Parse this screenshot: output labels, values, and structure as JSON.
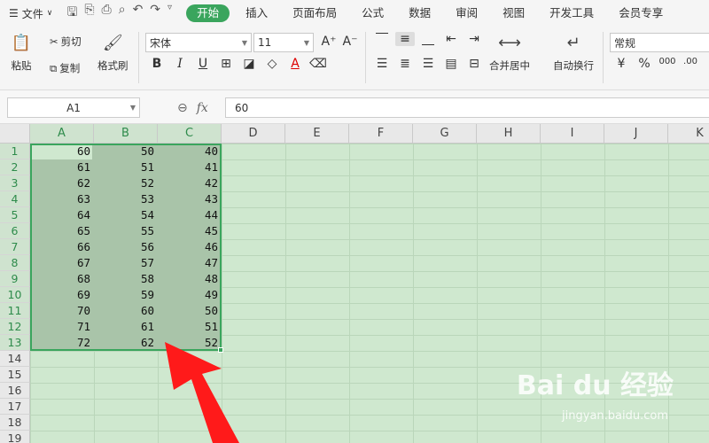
{
  "menu": {
    "file": "文件"
  },
  "tabs": [
    "开始",
    "插入",
    "页面布局",
    "公式",
    "数据",
    "审阅",
    "视图",
    "开发工具",
    "会员专享"
  ],
  "ribbon": {
    "paste": "粘贴",
    "cut": "剪切",
    "copy": "复制",
    "format_painter": "格式刷",
    "font_name": "宋体",
    "font_size": "11",
    "merge_center": "合并居中",
    "wrap_text": "自动换行",
    "number_format": "常规"
  },
  "formula_bar": {
    "name_box": "A1",
    "fx": "fx",
    "value": "60"
  },
  "columns": [
    "A",
    "B",
    "C",
    "D",
    "E",
    "F",
    "G",
    "H",
    "I",
    "J",
    "K"
  ],
  "rows": [
    "1",
    "2",
    "3",
    "4",
    "5",
    "6",
    "7",
    "8",
    "9",
    "10",
    "11",
    "12",
    "13",
    "14",
    "15",
    "16",
    "17",
    "18",
    "19"
  ],
  "data": [
    [
      "60",
      "50",
      "40"
    ],
    [
      "61",
      "51",
      "41"
    ],
    [
      "62",
      "52",
      "42"
    ],
    [
      "63",
      "53",
      "43"
    ],
    [
      "64",
      "54",
      "44"
    ],
    [
      "65",
      "55",
      "45"
    ],
    [
      "66",
      "56",
      "46"
    ],
    [
      "67",
      "57",
      "47"
    ],
    [
      "68",
      "58",
      "48"
    ],
    [
      "69",
      "59",
      "49"
    ],
    [
      "70",
      "60",
      "50"
    ],
    [
      "71",
      "61",
      "51"
    ],
    [
      "72",
      "62",
      "52"
    ]
  ],
  "watermark": {
    "brand": "Bai du 经验",
    "url": "jingyan.baidu.com"
  },
  "colors": {
    "accent": "#3aa55d",
    "arrow": "#ff1a1a"
  }
}
